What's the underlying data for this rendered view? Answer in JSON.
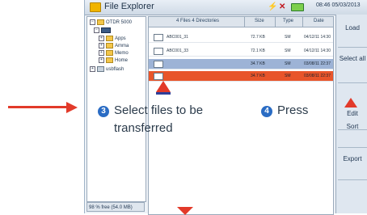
{
  "window": {
    "title": "File Explorer",
    "time": "08:46 05/03/2013"
  },
  "status_icons": {
    "plug": "plug-icon",
    "network": "network-icon",
    "battery": "battery-icon"
  },
  "tree": {
    "root": "OTDR 5000",
    "items": [
      "Apps",
      "Amma",
      "Memo",
      "Home"
    ],
    "usb": "usbflash",
    "free_space": "98 % free (54.0 MB)"
  },
  "file_list": {
    "header_main": "4 Files 4 Directories",
    "columns": [
      "Size",
      "Type",
      "Date"
    ],
    "rows": [
      {
        "name": "ABC001_31",
        "size": "72.7 KB",
        "type": "SM",
        "date": "04/12/11 14:30",
        "state": "normal"
      },
      {
        "name": "ABC001_33",
        "size": "72.1 KB",
        "type": "SM",
        "date": "04/12/11 14:30",
        "state": "normal"
      },
      {
        "name": "",
        "size": "34.7 KB",
        "type": "SM",
        "date": "03/08/11 22:37",
        "state": "selected-blue"
      },
      {
        "name": "",
        "size": "34.7 KB",
        "type": "SM",
        "date": "03/08/11 22:37",
        "state": "selected-orange"
      }
    ]
  },
  "softkeys": [
    "Load",
    "Select all",
    "Edit",
    "Sort",
    "Export"
  ],
  "annotations": {
    "step3_num": "3",
    "step3_line1": "Select files to be",
    "step3_line2": "transferred",
    "step4_num": "4",
    "step4_text": "Press"
  },
  "colors": {
    "accent_red": "#e23a2a",
    "badge_blue": "#2a6cc4",
    "select_blue": "#9db3d6",
    "select_orange": "#e8552a"
  }
}
